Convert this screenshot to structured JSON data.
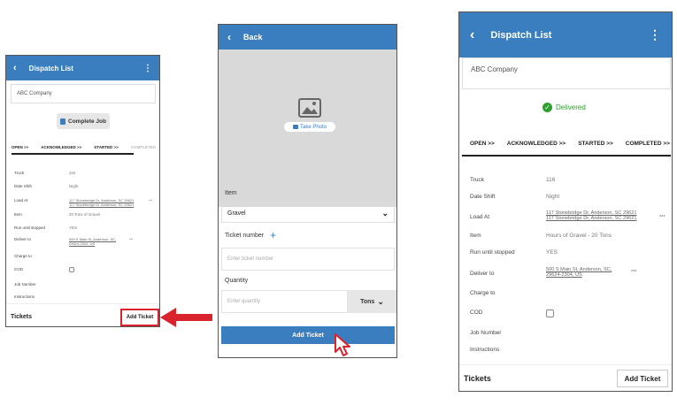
{
  "left": {
    "title": "Dispatch List",
    "company": "ABC Company",
    "complete_job": "Complete Job",
    "tabs": [
      "OPEN >>",
      "ACKNOWLEDGED >>",
      "STARTED >>",
      "COMPLETED"
    ],
    "fields": {
      "truck_label": "Truck",
      "truck_value": "116",
      "date_shift_label": "Date Shift",
      "date_shift_value": "Night",
      "load_at_label": "Load At",
      "load_at_1": "117 Stonebridge Dr, Anderson, SC 29621",
      "load_at_2": "117 Stonebridge Dr, Anderson, SC 29621",
      "item_label": "Item",
      "item_value": "20 Tons of Gravel",
      "run_label": "Run until stopped",
      "run_value": "YES",
      "deliver_label": "Deliver to",
      "deliver_1": "500 S Main St, Anderson, SC,",
      "deliver_2": "29624-2304, US",
      "charge_label": "Charge to",
      "cod_label": "COD",
      "job_label": "Job Number",
      "instructions_label": "Instructions"
    },
    "tickets_label": "Tickets",
    "add_ticket": "Add Ticket"
  },
  "middle": {
    "back": "Back",
    "take_photo": "Take Photo",
    "item_label": "Item",
    "item_value": "Gravel",
    "ticket_number_label": "Ticket number",
    "ticket_placeholder": "Enter ticket number",
    "quantity_label": "Quantity",
    "quantity_placeholder": "Enter quantity",
    "unit": "Tons",
    "add_ticket": "Add Ticket"
  },
  "right": {
    "title": "Dispatch List",
    "company": "ABC Company",
    "status": "Delivered",
    "tabs": [
      "OPEN >>",
      "ACKNOWLEDGED >>",
      "STARTED >>",
      "COMPLETED >>"
    ],
    "fields": {
      "truck_label": "Truck",
      "truck_value": "116",
      "date_shift_label": "Date Shift",
      "date_shift_value": "Night",
      "load_at_label": "Load At",
      "load_at_1": "117 Stonebridge Dr, Anderson, SC 29621",
      "load_at_2": "117 Stonebridge Dr, Anderson, SC 29621",
      "item_label": "Item",
      "item_value": "Hours of Gravel - 20 Tons",
      "run_label": "Run until stopped",
      "run_value": "YES",
      "deliver_label": "Deliver to",
      "deliver_1": "500 S Main St, Anderson, SC,",
      "deliver_2": "29624-2304, US",
      "charge_label": "Charge to",
      "cod_label": "COD",
      "job_label": "Job Number",
      "instructions_label": "Instructions"
    },
    "tickets_label": "Tickets",
    "add_ticket": "Add Ticket"
  },
  "colors": {
    "accent": "#3a7ec0",
    "highlight": "#d9232d",
    "delivered": "#2ea02e"
  }
}
